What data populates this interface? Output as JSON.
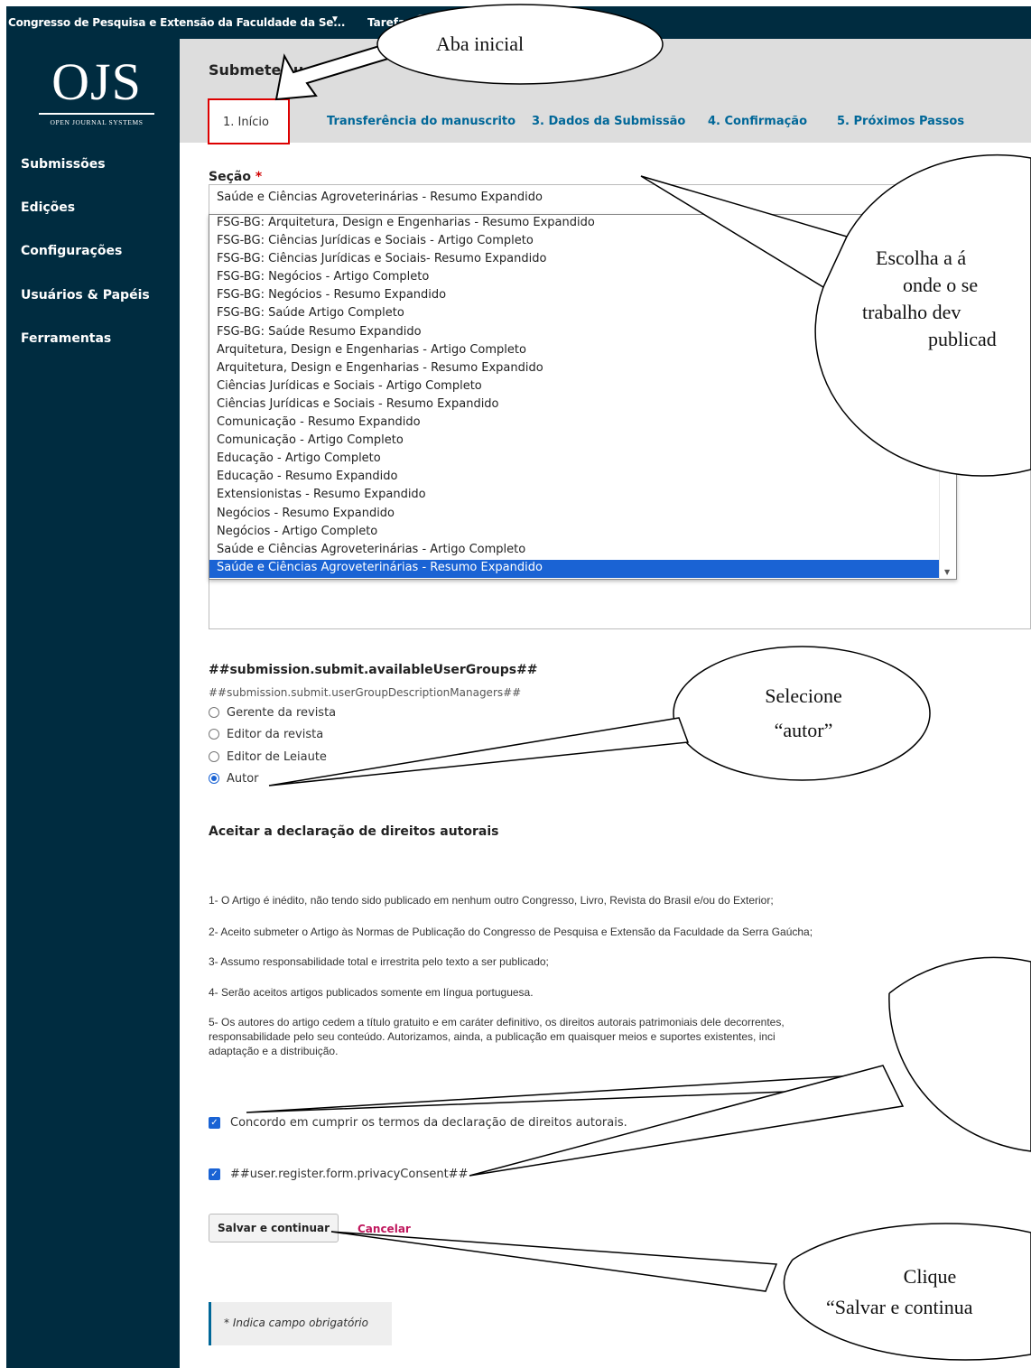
{
  "topbar": {
    "context_title": "Congresso de Pesquisa e Extensão da Faculdade da Se...",
    "caret": "▼",
    "tasks_label": "Tarefas"
  },
  "logo": {
    "mark": "OJS",
    "subtitle": "OPEN JOURNAL SYSTEMS"
  },
  "sidebar": {
    "items": [
      {
        "label": "Submissões"
      },
      {
        "label": "Edições"
      },
      {
        "label": "Configurações"
      },
      {
        "label": "Usuários & Papéis"
      },
      {
        "label": "Ferramentas"
      }
    ]
  },
  "header": {
    "page_title": "Submeter u",
    "tabs": [
      {
        "label": "1. Início"
      },
      {
        "label": "Transferência do manuscrito"
      },
      {
        "label": "3. Dados da Submissão"
      },
      {
        "label": "4. Confirmação"
      },
      {
        "label": "5. Próximos Passos"
      }
    ]
  },
  "section_field": {
    "label": "Seção",
    "required_mark": "*",
    "selected_value": "Saúde e Ciências Agroveterinárias - Resumo Expandido",
    "options": [
      "FSG-BG: Arquitetura, Design e Engenharias - Resumo Expandido",
      "FSG-BG: Ciências Jurídicas e Sociais - Artigo Completo",
      "FSG-BG: Ciências Jurídicas e Sociais- Resumo Expandido",
      "FSG-BG: Negócios - Artigo Completo",
      "FSG-BG: Negócios - Resumo Expandido",
      "FSG-BG: Saúde Artigo Completo",
      "FSG-BG: Saúde Resumo Expandido",
      "Arquitetura, Design e Engenharias - Artigo Completo",
      "Arquitetura, Design e Engenharias - Resumo Expandido",
      "Ciências Jurídicas e Sociais - Artigo Completo",
      "Ciências Jurídicas e Sociais - Resumo Expandido",
      "Comunicação - Resumo Expandido",
      "Comunicação - Artigo Completo",
      "Educação - Artigo Completo",
      "Educação - Resumo Expandido",
      "Extensionistas - Resumo Expandido",
      "Negócios - Resumo Expandido",
      "Negócios - Artigo Completo",
      "Saúde e Ciências Agroveterinárias - Artigo Completo",
      "Saúde e Ciências Agroveterinárias - Resumo Expandido"
    ],
    "scroll_arrow": "▼"
  },
  "user_groups": {
    "title": "##submission.submit.availableUserGroups##",
    "description": "##submission.submit.userGroupDescriptionManagers##",
    "options": [
      {
        "label": "Gerente da revista",
        "checked": false
      },
      {
        "label": "Editor da revista",
        "checked": false
      },
      {
        "label": "Editor de Leiaute",
        "checked": false
      },
      {
        "label": "Autor",
        "checked": true
      }
    ]
  },
  "copyright": {
    "title": "Aceitar a declaração de direitos autorais",
    "items": [
      "1- O Artigo é inédito, não tendo sido publicado em nenhum outro Congresso, Livro, Revista do Brasil e/ou do Exterior;",
      "2- Aceito submeter o Artigo às Normas de Publicação do Congresso de Pesquisa e Extensão da Faculdade da Serra Gaúcha;",
      "3- Assumo responsabilidade total e irrestrita pelo texto a ser publicado;",
      "4- Serão aceitos artigos publicados somente em língua portuguesa.",
      "5- Os autores do artigo cedem a título gratuito e em caráter definitivo, os direitos autorais patrimoniais dele decorrentes,",
      "responsabilidade pelo seu conteúdo. Autorizamos, ainda, a publicação em quaisquer meios e suportes existentes, inci",
      "adaptação e a distribuição."
    ],
    "agree_label": "Concordo em cumprir os termos da declaração de direitos autorais.",
    "agree_checked": true,
    "privacy_label": "##user.register.form.privacyConsent##",
    "privacy_checked": true
  },
  "actions": {
    "save_label": "Salvar e continuar",
    "cancel_label": "Cancelar"
  },
  "required_note": "* Indica campo obrigatório",
  "callouts": {
    "aba_inicial": "Aba inicial",
    "escolha_lines": [
      "Escolha a á",
      "onde o se",
      "trabalho dev",
      "publicad"
    ],
    "selecione_lines": [
      "Selecione",
      "“autor”"
    ],
    "clique_lines": [
      "Clique",
      "“Salvar e continua"
    ]
  },
  "colors": {
    "sidebar": "#002c40",
    "link": "#006798",
    "selected": "#1a63d4",
    "cancel": "#c0175d",
    "required": "#d00000"
  }
}
